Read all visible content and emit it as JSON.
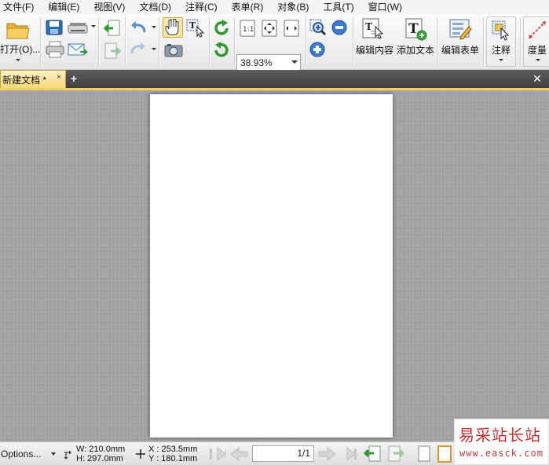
{
  "menu": [
    "文件(F)",
    "编辑(E)",
    "视图(V)",
    "文档(D)",
    "注释(C)",
    "表单(R)",
    "对象(B)",
    "工具(T)",
    "窗口(W)"
  ],
  "toolbar": {
    "open_label": "打开(O)...",
    "zoom_value": "38.93%",
    "edit_content_label": "编辑内容",
    "add_text_label": "添加文本",
    "edit_form_label": "编辑表单",
    "comment_label": "注释",
    "measure_label": "度量"
  },
  "tabs": {
    "document_title": "新建文档 *",
    "close_tab": "×",
    "new_tab": "+",
    "close_all": "✕"
  },
  "statusbar": {
    "options_label": "Options...",
    "width": "W: 210.0mm",
    "height": "H: 297.0mm",
    "x_coord": "X : 253.5mm",
    "y_coord": "Y : 180.1mm",
    "page_indicator": "1/1"
  },
  "watermark": {
    "text": "易采站长站",
    "url": "www.easck.com"
  },
  "colors": {
    "accent": "#f6d774",
    "workspace": "#a3a3a3",
    "tabstrip": "#4a4a4a"
  }
}
